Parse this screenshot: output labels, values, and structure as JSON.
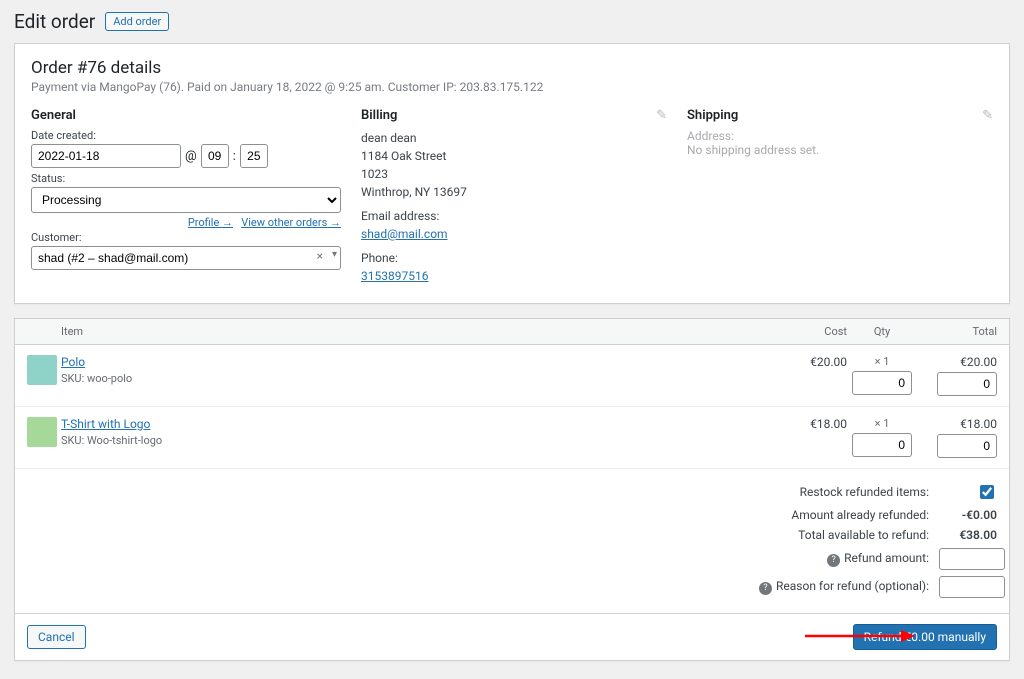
{
  "header": {
    "title": "Edit order",
    "add": "Add order"
  },
  "details": {
    "heading": "Order #76 details",
    "sub": "Payment via MangoPay (76). Paid on January 18, 2022 @ 9:25 am. Customer IP: 203.83.175.122"
  },
  "general": {
    "title": "General",
    "date_label": "Date created:",
    "date": "2022-01-18",
    "at": "@",
    "hh": "09",
    "sep": ":",
    "mm": "25",
    "status_label": "Status:",
    "status": "Processing",
    "cust_label": "Customer:",
    "cust": "shad (#2 – shad@mail.com)",
    "profile": "Profile →",
    "other": "View other orders →"
  },
  "billing": {
    "title": "Billing",
    "name": "dean dean",
    "street": "1184 Oak Street",
    "unit": "1023",
    "city": "Winthrop, NY 13697",
    "email_l": "Email address:",
    "email": "shad@mail.com",
    "phone_l": "Phone:",
    "phone": "3153897516"
  },
  "shipping": {
    "title": "Shipping",
    "addr_l": "Address:",
    "none": "No shipping address set."
  },
  "items": {
    "h_item": "Item",
    "h_cost": "Cost",
    "h_qty": "Qty",
    "h_total": "Total",
    "rows": [
      {
        "name": "Polo",
        "sku": "SKU: woo-polo",
        "cost": "€20.00",
        "qty": "× 1",
        "qin": "0",
        "total": "€20.00",
        "tin": "0",
        "color": "#8fd3c8"
      },
      {
        "name": "T-Shirt with Logo",
        "sku": "SKU: Woo-tshirt-logo",
        "cost": "€18.00",
        "qty": "× 1",
        "qin": "0",
        "total": "€18.00",
        "tin": "0",
        "color": "#a6d89a"
      }
    ]
  },
  "refund": {
    "restock_l": "Restock refunded items:",
    "restock": true,
    "already_l": "Amount already refunded:",
    "already": "-€0.00",
    "avail_l": "Total available to refund:",
    "avail": "€38.00",
    "amount_l": "Refund amount:",
    "amount": "",
    "reason_l": "Reason for refund (optional):",
    "reason": ""
  },
  "footer": {
    "cancel": "Cancel",
    "refund": "Refund €0.00 manually"
  }
}
